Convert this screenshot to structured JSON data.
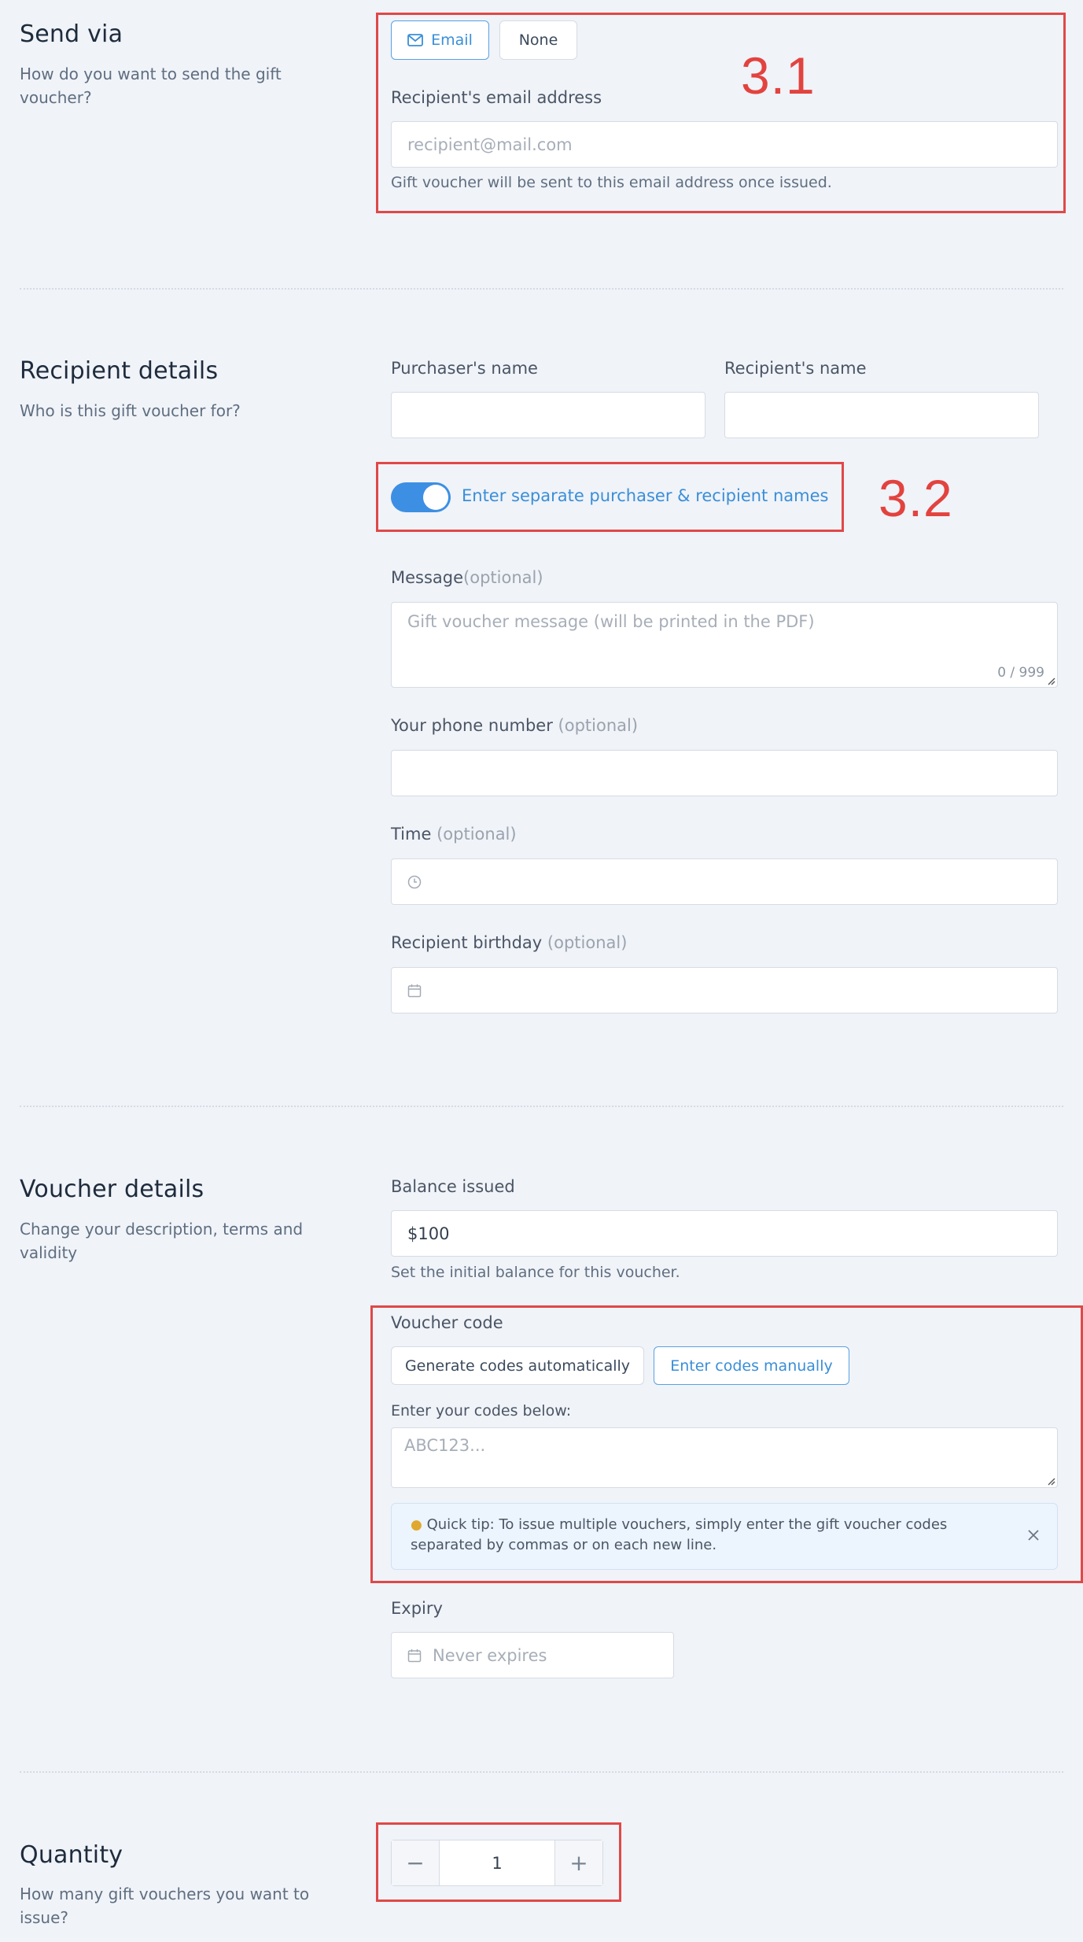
{
  "send_via": {
    "title": "Send via",
    "description": "How do you want to send the gift voucher?",
    "email_button": "Email",
    "none_button": "None",
    "email_label": "Recipient's email address",
    "email_placeholder": "recipient@mail.com",
    "email_help": "Gift voucher will be sent to this email address once issued."
  },
  "recipient": {
    "title": "Recipient details",
    "description": "Who is this gift voucher for?",
    "purchaser_label": "Purchaser's name",
    "recipient_label": "Recipient's name",
    "toggle_label": "Enter separate purchaser & recipient names",
    "toggle_on": true,
    "message_label": "Message",
    "message_optional": "(optional)",
    "message_placeholder": "Gift voucher message (will be printed in the PDF)",
    "message_counter": "0 / 999",
    "phone_label": "Your phone number",
    "phone_optional": "(optional)",
    "time_label": "Time",
    "time_optional": "(optional)",
    "birthday_label": "Recipient birthday",
    "birthday_optional": "(optional)"
  },
  "voucher": {
    "title": "Voucher details",
    "description": "Change your description, terms and validity",
    "balance_label": "Balance issued",
    "balance_value": "$100",
    "balance_help": "Set the initial balance for this voucher.",
    "code_label": "Voucher code",
    "auto_button": "Generate codes automatically",
    "manual_button": "Enter codes manually",
    "codes_label": "Enter your codes below:",
    "codes_placeholder": "ABC123...",
    "tip_text": "Quick tip: To issue multiple vouchers, simply enter the gift voucher codes separated by commas or on each new line.",
    "expiry_label": "Expiry",
    "expiry_placeholder": "Never expires"
  },
  "quantity": {
    "title": "Quantity",
    "description": "How many gift vouchers you want to issue?",
    "value": "1",
    "minus": "−",
    "plus": "+"
  },
  "annotations": {
    "a1": "3.1",
    "a2": "3.2"
  },
  "colors": {
    "accent": "#3d8fe3",
    "annotation": "#e04848",
    "background": "#f0f3f8"
  }
}
